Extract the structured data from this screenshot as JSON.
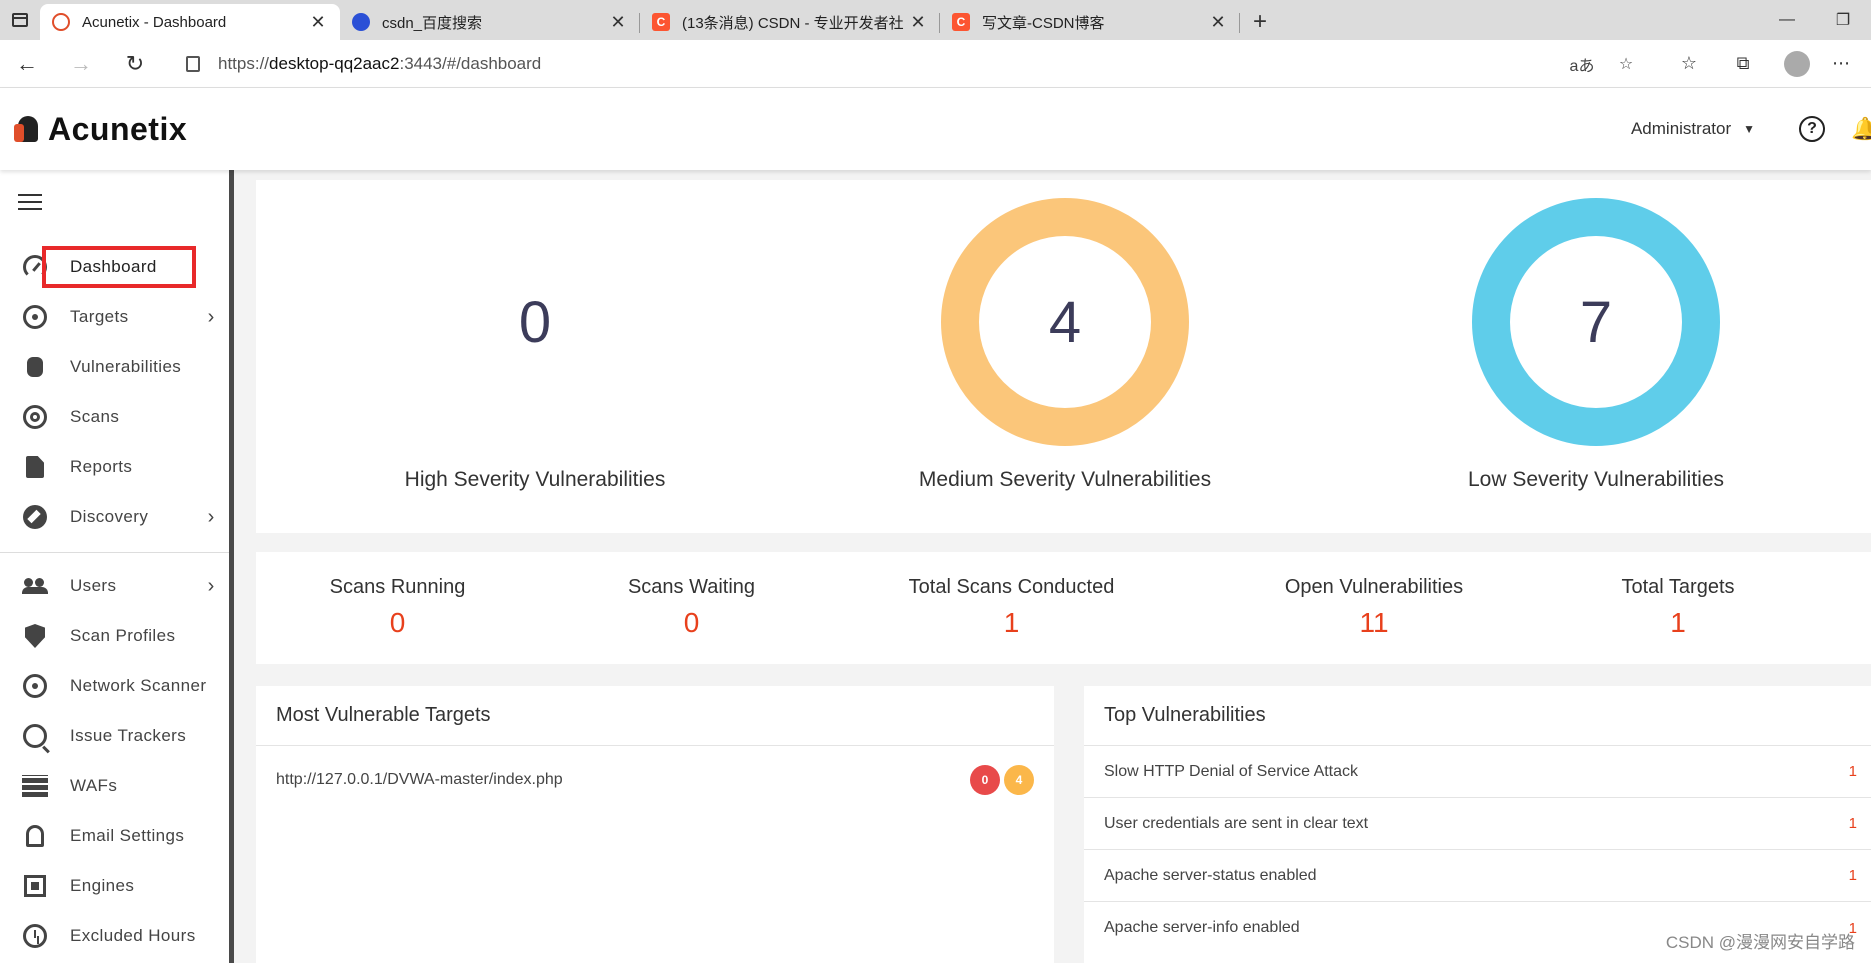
{
  "browser": {
    "tabs": [
      {
        "label": "Acunetix - Dashboard",
        "favicon": "acunetix-icon"
      },
      {
        "label": "csdn_百度搜索",
        "favicon": "baidu-icon"
      },
      {
        "label": "(13条消息) CSDN - 专业开发者社",
        "favicon": "csdn-icon"
      },
      {
        "label": "写文章-CSDN博客",
        "favicon": "csdn-icon"
      }
    ],
    "url_prefix": "https://",
    "url_host": "desktop-qq2aac2",
    "url_rest": ":3443/#/dashboard"
  },
  "header": {
    "brand": "Acunetix",
    "user": "Administrator"
  },
  "sidebar": {
    "items": [
      {
        "label": "Dashboard",
        "icon": "gauge-icon"
      },
      {
        "label": "Targets",
        "icon": "target-icon"
      },
      {
        "label": "Vulnerabilities",
        "icon": "bug-icon"
      },
      {
        "label": "Scans",
        "icon": "scan-icon"
      },
      {
        "label": "Reports",
        "icon": "document-icon"
      },
      {
        "label": "Discovery",
        "icon": "compass-icon"
      },
      {
        "label": "Users",
        "icon": "users-icon"
      },
      {
        "label": "Scan Profiles",
        "icon": "shield-icon"
      },
      {
        "label": "Network Scanner",
        "icon": "network-icon"
      },
      {
        "label": "Issue Trackers",
        "icon": "issue-icon"
      },
      {
        "label": "WAFs",
        "icon": "waf-icon"
      },
      {
        "label": "Email Settings",
        "icon": "bell-icon"
      },
      {
        "label": "Engines",
        "icon": "chip-icon"
      },
      {
        "label": "Excluded Hours",
        "icon": "clock-icon"
      }
    ]
  },
  "severity": {
    "high": {
      "label": "High Severity Vulnerabilities",
      "value": "0"
    },
    "medium": {
      "label": "Medium Severity Vulnerabilities",
      "value": "4"
    },
    "low": {
      "label": "Low Severity Vulnerabilities",
      "value": "7"
    }
  },
  "stats": [
    {
      "label": "Scans Running",
      "value": "0"
    },
    {
      "label": "Scans Waiting",
      "value": "0"
    },
    {
      "label": "Total Scans Conducted",
      "value": "1"
    },
    {
      "label": "Open Vulnerabilities",
      "value": "11"
    },
    {
      "label": "Total Targets",
      "value": "1"
    }
  ],
  "most_vulnerable": {
    "title": "Most Vulnerable Targets",
    "rows": [
      {
        "url": "http://127.0.0.1/DVWA-master/index.php",
        "high": "0",
        "medium": "4"
      }
    ]
  },
  "top_vulnerabilities": {
    "title": "Top Vulnerabilities",
    "rows": [
      {
        "name": "Slow HTTP Denial of Service Attack",
        "count": "1"
      },
      {
        "name": "User credentials are sent in clear text",
        "count": "1"
      },
      {
        "name": "Apache server-status enabled",
        "count": "1"
      },
      {
        "name": "Apache server-info enabled",
        "count": "1"
      }
    ]
  },
  "watermark": "CSDN @漫漫网安自学路",
  "colors": {
    "medium": "#fbc67a",
    "low": "#5fcdea",
    "accent": "#e8401c",
    "highlight": "#e8292a"
  }
}
